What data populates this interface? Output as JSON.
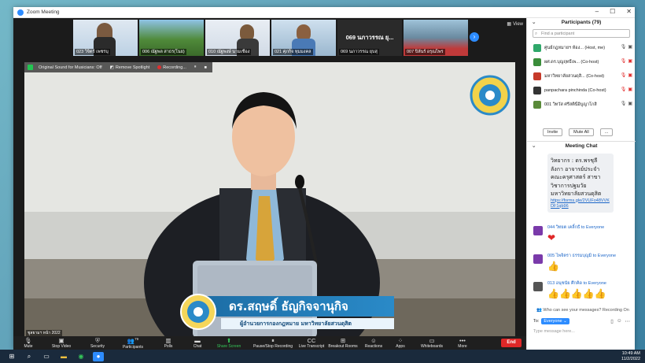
{
  "window": {
    "title": "Zoom Meeting"
  },
  "strip": {
    "thumbs": [
      {
        "name": "023 วิจิตร์ เพชรบุ"
      },
      {
        "name": "006 ณัฐพล สาธร(โนย)"
      },
      {
        "name": "010 ณัฐพงษ์ นามเชื่อง"
      },
      {
        "name": "021 ศุภกิจ ทุมมงคล"
      },
      {
        "name": "069 นภาวรรณ ยุบสุ"
      },
      {
        "name": "007 ปิลันร์ อรุณไพร"
      }
    ],
    "big_label": "069 นภาวรรณ ยุ...",
    "view_label": "View"
  },
  "video_toolbar": {
    "original_sound": "Original Sound for Musicians: Off",
    "remove_spotlight": "Remove Spotlight",
    "recording": "Recording..."
  },
  "speaker_corner_label": "ชูสยามฯ หน้า 2022",
  "banner": {
    "name": "ดร.สฤษดิ์ ธัญกิจจานุกิจ",
    "subtitle": "ผู้อำนวยการกองกฎหมาย มหาวิทยาลัยสวนดุสิต"
  },
  "toolbar": {
    "items": [
      {
        "icon": "microphone-icon",
        "glyph": "🎙",
        "label": "Mute"
      },
      {
        "icon": "video-camera-icon",
        "glyph": "▣",
        "label": "Stop Video"
      },
      {
        "icon": "shield-icon",
        "glyph": "⛨",
        "label": "Security"
      },
      {
        "icon": "participants-icon",
        "glyph": "👥",
        "label": "Participants",
        "count": "79"
      },
      {
        "icon": "polls-icon",
        "glyph": "▥",
        "label": "Polls"
      },
      {
        "icon": "chat-icon",
        "glyph": "▬",
        "label": "Chat"
      },
      {
        "icon": "share-screen-icon",
        "glyph": "⬆",
        "label": "Share Screen"
      },
      {
        "icon": "record-icon",
        "glyph": "⏸",
        "label": "Pause/Stop Recording"
      },
      {
        "icon": "transcript-icon",
        "glyph": "CC",
        "label": "Live Transcript"
      },
      {
        "icon": "breakout-rooms-icon",
        "glyph": "⊞",
        "label": "Breakout Rooms"
      },
      {
        "icon": "reactions-icon",
        "glyph": "☺",
        "label": "Reactions"
      },
      {
        "icon": "apps-icon",
        "glyph": "⁘",
        "label": "Apps"
      },
      {
        "icon": "whiteboard-icon",
        "glyph": "▭",
        "label": "Whiteboards"
      },
      {
        "icon": "more-icon",
        "glyph": "•••",
        "label": "More"
      }
    ],
    "end_label": "End"
  },
  "participants": {
    "title": "Participants (79)",
    "search_placeholder": "Find a participant",
    "list": [
      {
        "name": "ศูนย์กฎหมายฯ ห้อง... (Host, me)",
        "color": "#2fa86a"
      },
      {
        "name": "ผศ.ดร.บุญฤทธิ์เพ... (Co-host)",
        "color": "#3a8d3a"
      },
      {
        "name": "มหาวิทยาลัยสวนดุสิ... (Co-host)",
        "color": "#c63a2a"
      },
      {
        "name": "panpachara pinchinda (Co-host)",
        "color": "#333"
      },
      {
        "name": "001 วิทวัส ศรีสตินิ์อิบูญาโกสิ",
        "color": "#5a8a3a"
      }
    ],
    "invite_label": "Invite",
    "mute_all_label": "Mute All",
    "more_label": "..."
  },
  "chat": {
    "title": "Meeting Chat",
    "bubble_text": "วิทยากร : ดร.พรชุลี ลังกา อาจารย์ประจำคณะครุศาสตร์ สาขาวิชาการปฐมวัย มหาวิทยาลัยสวนดุสิต",
    "bubble_link": "https://forms.gle/2VUFo48VVKDF1qb96",
    "messages": [
      {
        "header": "044 วิทยต เคลิ้กธี to Everyone",
        "body": "❤",
        "color": "#7a3aaa"
      },
      {
        "header": "005 ไพจิตรา ธรรมบุญมิ to Everyone",
        "body": "👍",
        "color": "#7a3aaa"
      },
      {
        "header": "013 อนุชนัย ศึกคิด to Everyone",
        "body": "👍👍👍👍👍",
        "color": "#555"
      }
    ],
    "who_can_see": "Who can see your messages? Recording On",
    "to_label": "To:",
    "to_value": "Everyone",
    "input_placeholder": "Type message here..."
  },
  "taskbar": {
    "time": "10:49 AM",
    "date": "11/2/2022"
  }
}
